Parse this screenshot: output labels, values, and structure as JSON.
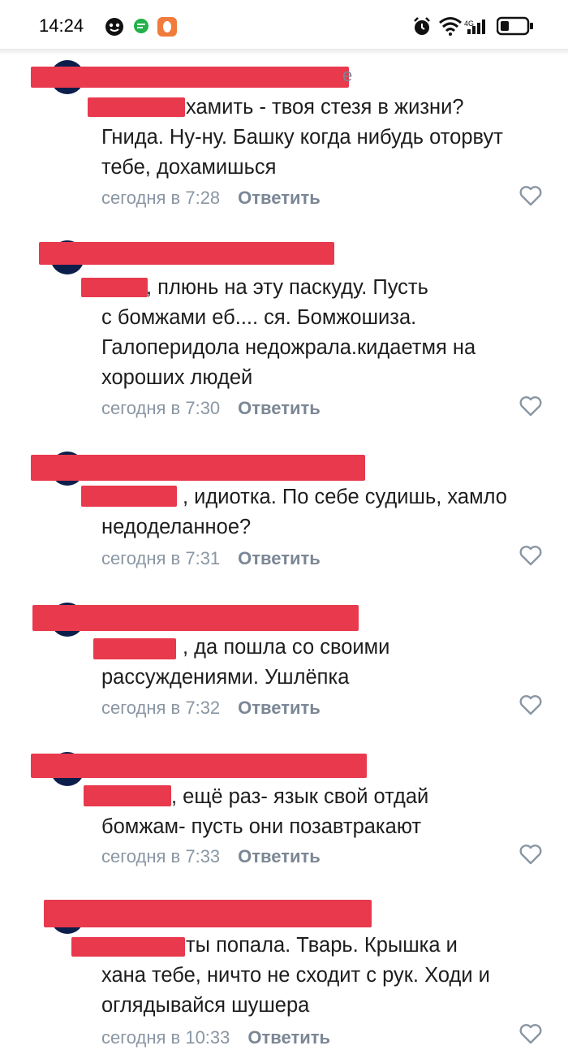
{
  "status_bar": {
    "time": "14:24",
    "icons": [
      "face-app-icon",
      "chat-app-icon",
      "orange-app-icon",
      "alarm-icon",
      "wifi-icon",
      "signal-icon",
      "battery-icon"
    ]
  },
  "comments": [
    {
      "name_tail": "е",
      "text_first": "хамить - твоя стезя в жизни?",
      "text_rest": "Гнида. Ну-ну. Башку когда нибудь оторвут тебе, дохамишься",
      "time": "сегодня в 7:28",
      "reply": "Ответить"
    },
    {
      "name_tail": "",
      "text_first": ", плюнь на эту паскуду. Пусть",
      "text_rest": "с бомжами еб.... ся. Бомжошиза. Галоперидола недожрала.кидаетмя на хороших людей",
      "time": "сегодня в 7:30",
      "reply": "Ответить"
    },
    {
      "name_tail": "",
      "text_first": ", идиотка. По себе судишь, хамло",
      "text_rest": "недоделанное?",
      "time": "сегодня в 7:31",
      "reply": "Ответить"
    },
    {
      "name_tail": "",
      "text_first": ", да пошла со своими",
      "text_rest": "рассуждениями. Ушлёпка",
      "time": "сегодня в 7:32",
      "reply": "Ответить"
    },
    {
      "name_tail": "",
      "text_first": ", ещё раз- язык свой отдай",
      "text_rest": "бомжам- пусть они позавтракают",
      "time": "сегодня в 7:33",
      "reply": "Ответить"
    },
    {
      "name_tail": "",
      "text_first": "ты попала. Тварь. Крышка и",
      "text_rest": "хана тебе, ничто не сходит с рук. Ходи и оглядывайся шушера",
      "time": "сегодня в 10:33",
      "reply": "Ответить"
    }
  ],
  "colors": {
    "redaction": "#e8394d",
    "meta": "#8a96a3",
    "avatar": "#0c1e4a"
  }
}
